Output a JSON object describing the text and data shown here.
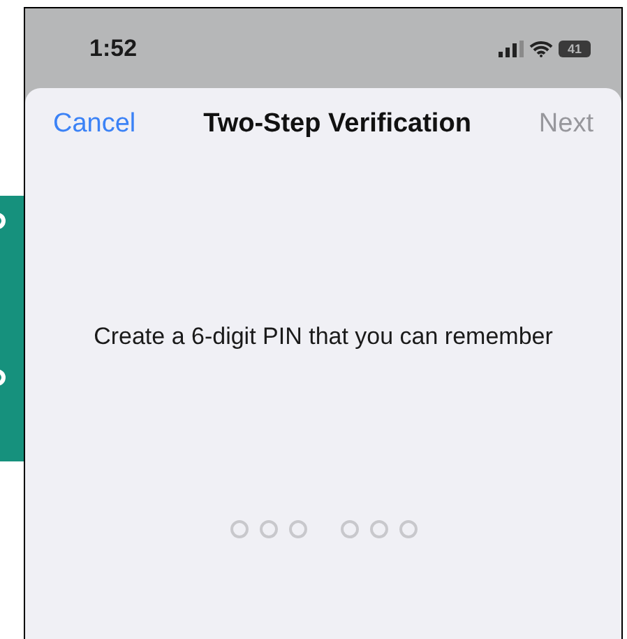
{
  "status_bar": {
    "time": "1:52",
    "battery": "41"
  },
  "header": {
    "cancel": "Cancel",
    "title": "Two-Step Verification",
    "next": {
      "label": "Next",
      "disabled": true
    }
  },
  "prompt": "Create a 6-digit PIN that you can remember",
  "pin_slots": [
    {
      "filled": false
    },
    {
      "filled": false
    },
    {
      "filled": false
    },
    {
      "filled": false
    },
    {
      "filled": false
    },
    {
      "filled": false
    }
  ]
}
